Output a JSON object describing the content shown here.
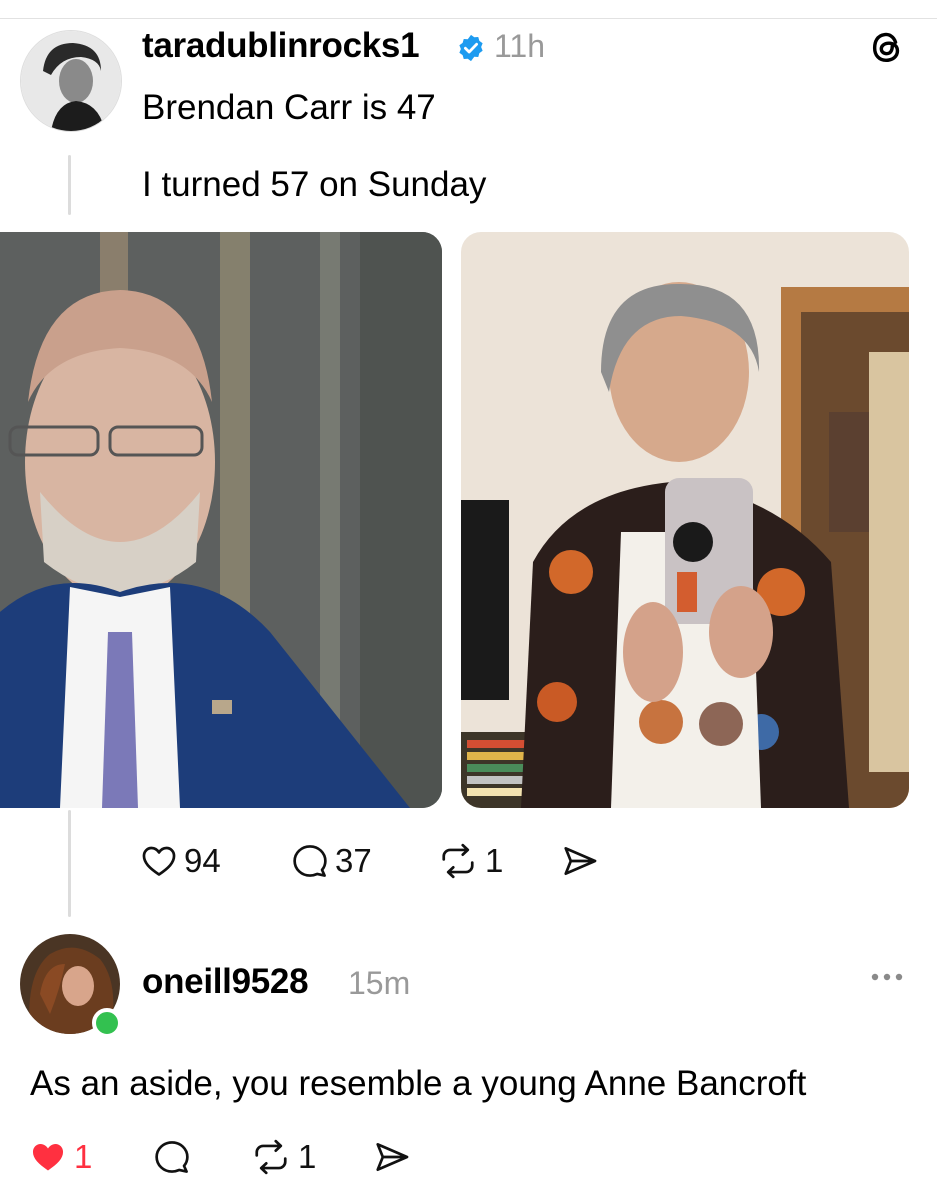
{
  "post": {
    "username": "taradublinrocks1",
    "time": "11h",
    "verified": true,
    "lines": [
      "Brendan Carr is 47",
      "I turned 57 on Sunday"
    ],
    "actions": {
      "likes": "94",
      "replies": "37",
      "reposts": "1"
    }
  },
  "reply": {
    "username": "oneill9528",
    "time": "15m",
    "online": true,
    "text": "As an aside, you resemble a young Anne Bancroft",
    "actions": {
      "likes": "1",
      "reposts": "1"
    }
  },
  "colors": {
    "verified": "#1d9bf0",
    "like_active": "#ff3040",
    "online": "#33c150"
  },
  "icons": [
    "threads-logo-icon",
    "verified-badge-icon",
    "heart-icon",
    "comment-icon",
    "repost-icon",
    "share-icon",
    "more-options-icon"
  ]
}
